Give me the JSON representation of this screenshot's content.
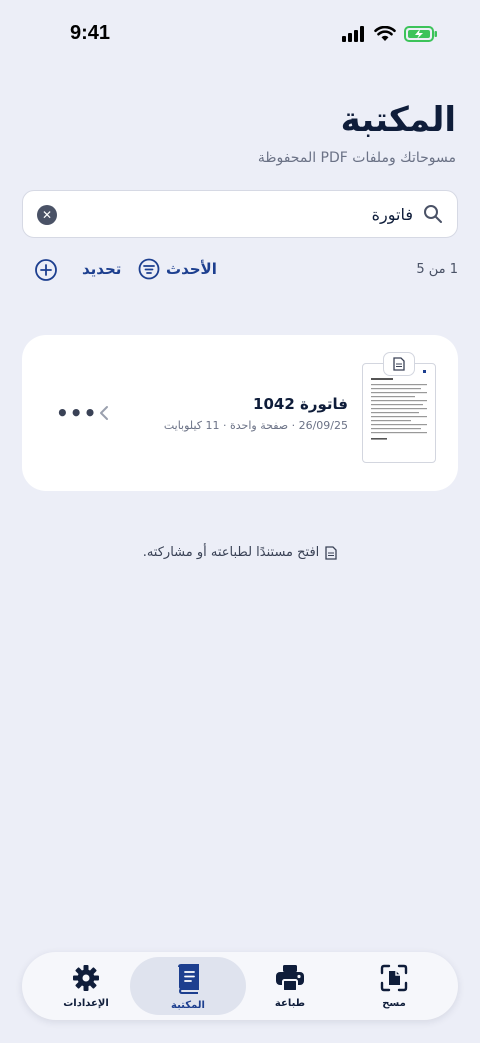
{
  "status": {
    "time": "9:41"
  },
  "header": {
    "title": "المكتبة",
    "subtitle": "مسوحاتك وملفات PDF المحفوظة"
  },
  "search": {
    "value": "فاتورة",
    "clear": "✕"
  },
  "toolbar": {
    "count": "1 من 5",
    "sort_label": "الأحدث",
    "select_label": "تحديد"
  },
  "document": {
    "title": "فاتورة 1042",
    "meta": "26/09/25 · صفحة واحدة · 11 كيلوبايت",
    "more": "•••"
  },
  "hint": "افتح مستندًا لطباعته أو مشاركته.",
  "tabs": [
    {
      "label": "الإعدادات",
      "icon": "gear-icon"
    },
    {
      "label": "المكتبة",
      "icon": "book-icon",
      "active": true
    },
    {
      "label": "طباعة",
      "icon": "printer-icon"
    },
    {
      "label": "مسح",
      "icon": "scan-icon"
    }
  ],
  "colors": {
    "accent": "#1d3f8f",
    "background": "#eceef7",
    "battery": "#3cc35a"
  }
}
